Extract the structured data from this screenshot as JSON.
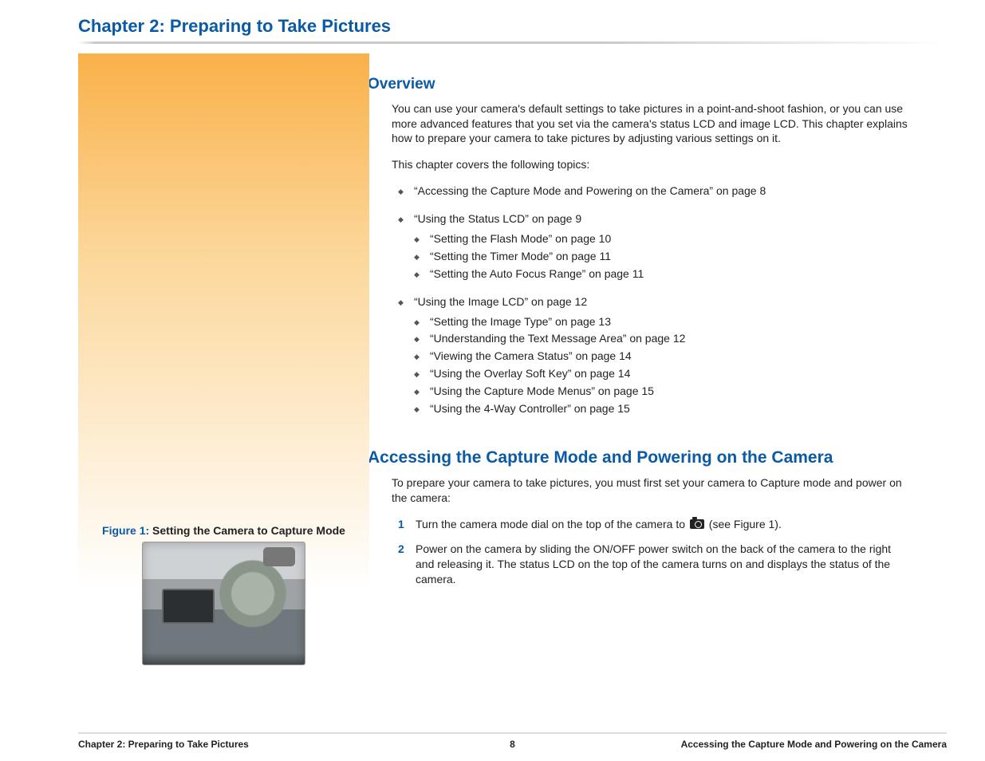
{
  "chapter_title": "Chapter 2: Preparing to Take Pictures",
  "overview": {
    "heading": "Overview",
    "intro": "You can use your camera's default settings to take pictures in a point-and-shoot fashion, or you can use more advanced features that you set via the camera's status LCD and image LCD. This chapter explains how to prepare your camera to take pictures by adjusting various settings on it.",
    "topics_lead": "This chapter covers the following topics:",
    "topics": {
      "t1": "“Accessing the Capture Mode and Powering on the Camera” on page 8",
      "t2": "“Using the Status LCD” on page 9",
      "t2a": "“Setting the Flash Mode” on page 10",
      "t2b": "“Setting the Timer Mode” on page 11",
      "t2c": "“Setting the Auto Focus Range” on page 11",
      "t3": "“Using the Image LCD” on page 12",
      "t3a": "“Setting the Image Type” on page 13",
      "t3b": "“Understanding the Text Message Area” on page 12",
      "t3c": "“Viewing the Camera Status” on page 14",
      "t3d": "“Using the Overlay Soft Key” on page 14",
      "t3e": "“Using the Capture Mode Menus” on page 15",
      "t3f": "“Using the 4-Way Controller” on page 15"
    }
  },
  "section2": {
    "heading": "Accessing the Capture Mode and Powering on the Camera",
    "intro": "To prepare your camera to take pictures, you must first set your camera to Capture mode and power on the camera:",
    "step1_a": "Turn the camera mode dial on the top of the camera to ",
    "step1_b": " (see Figure 1).",
    "step2": "Power on the camera by sliding the ON/OFF power switch on the back of the camera to the right and releasing it. The status LCD on the top of the camera turns on and displays the status of the camera.",
    "num1": "1",
    "num2": "2"
  },
  "figure": {
    "label": "Figure 1:",
    "caption": " Setting the Camera to Capture Mode"
  },
  "footer": {
    "left": "Chapter 2: Preparing to Take Pictures",
    "center": "8",
    "right": "Accessing the Capture Mode and Powering on the Camera"
  }
}
